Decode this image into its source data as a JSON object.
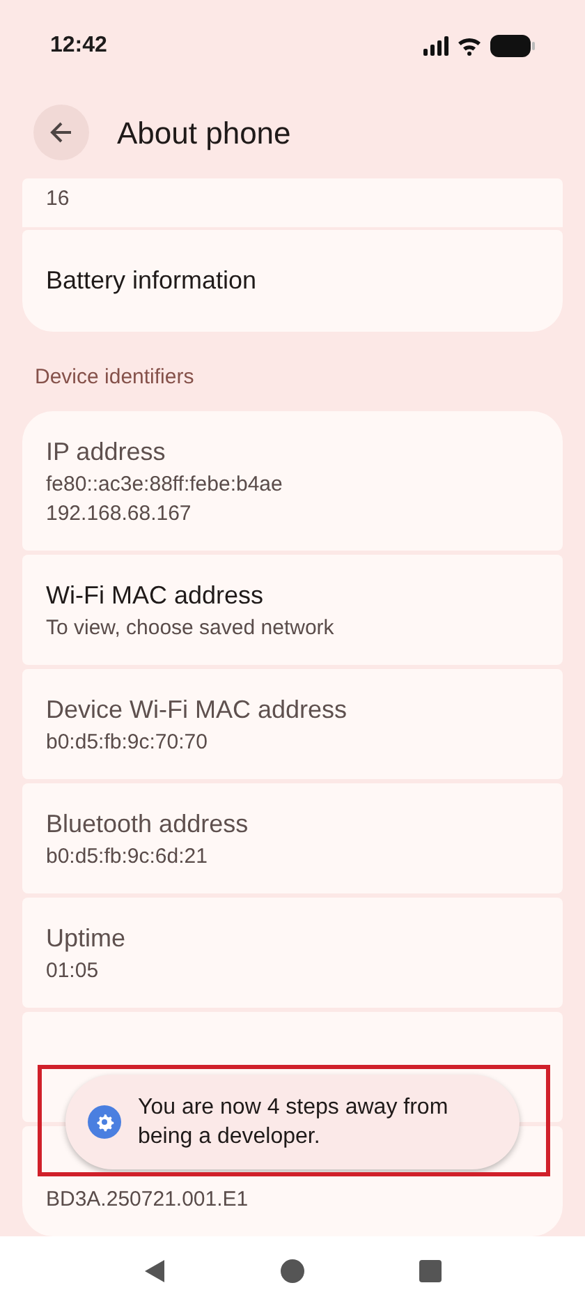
{
  "status_bar": {
    "time": "12:42"
  },
  "header": {
    "title": "About phone"
  },
  "top_items": [
    {
      "summary": "16"
    },
    {
      "title": "Battery information"
    }
  ],
  "section": {
    "label": "Device identifiers"
  },
  "items": [
    {
      "title": "IP address",
      "summary": "fe80::ac3e:88ff:febe:b4ae\n192.168.68.167",
      "disabled": true
    },
    {
      "title": "Wi-Fi MAC address",
      "summary": "To view, choose saved network",
      "disabled": false
    },
    {
      "title": "Device Wi-Fi MAC address",
      "summary": "b0:d5:fb:9c:70:70",
      "disabled": true
    },
    {
      "title": "Bluetooth address",
      "summary": "b0:d5:fb:9c:6d:21",
      "disabled": true
    },
    {
      "title": "Uptime",
      "summary": "01:05",
      "disabled": true
    },
    {
      "kind": "covered"
    },
    {
      "kind": "covered",
      "summary": "BD3A.250721.001.E1"
    }
  ],
  "toast": {
    "message": "You are now 4 steps away from being a developer."
  },
  "highlight": {
    "kind": "frame"
  }
}
